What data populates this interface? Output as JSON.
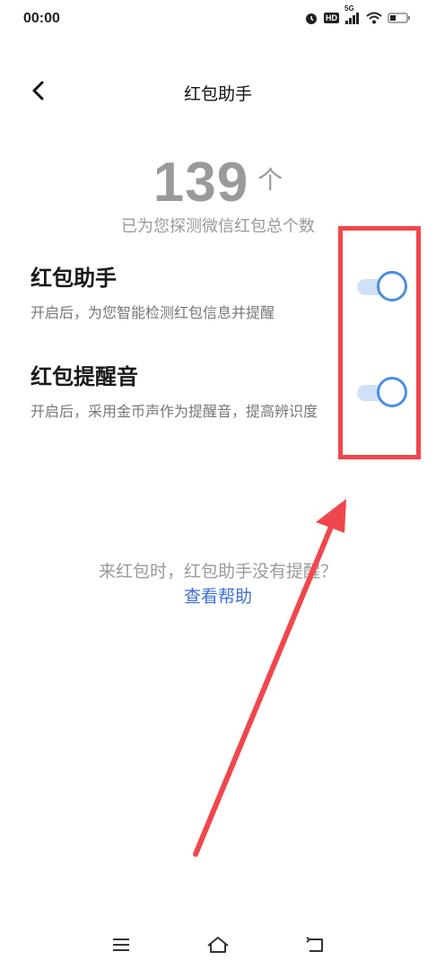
{
  "status_bar": {
    "time": "00:00",
    "network": "5G",
    "hd": "HD",
    "icons": [
      "alarm-icon",
      "hd-icon",
      "signal-icon",
      "wifi-icon",
      "battery-icon"
    ]
  },
  "header": {
    "title": "红包助手",
    "back_icon": "chevron-left-icon"
  },
  "counter": {
    "value": "139",
    "unit": "个",
    "description": "已为您探测微信红包总个数"
  },
  "settings": [
    {
      "title": "红包助手",
      "description": "开启后，为您智能检测红包信息并提醒",
      "enabled": true
    },
    {
      "title": "红包提醒音",
      "description": "开启后，采用金币声作为提醒音，提高辨识度",
      "enabled": true
    }
  ],
  "help": {
    "question": "来红包时，红包助手没有提醒？",
    "link": "查看帮助"
  },
  "nav_bar": {
    "icons": [
      "menu-icon",
      "home-icon",
      "back-icon"
    ]
  },
  "colors": {
    "accent": "#4a8fe0",
    "link": "#3d6fd6",
    "annotation": "#f0474c",
    "muted_text": "#9a9a9a"
  }
}
